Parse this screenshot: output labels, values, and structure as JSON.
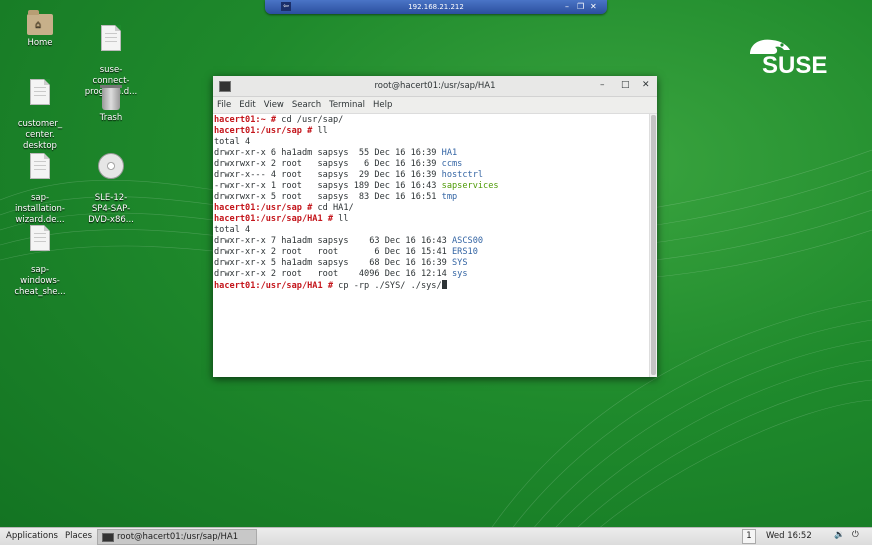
{
  "remote": {
    "address": "192.168.21.212",
    "pin_glyph": "⇦",
    "minimize_glyph": "–",
    "restore_glyph": "❐",
    "close_glyph": "✕"
  },
  "desktop": {
    "home_label": "Home",
    "suse_connect_label": "suse-\nconnect-\nprogram.d...",
    "customer_center_label": "customer_\ncenter.\ndesktop",
    "trash_label": "Trash",
    "sap_installation_label": "sap-\ninstallation-\nwizard.de...",
    "sle_dvd_label": "SLE-12-\nSP4-SAP-\nDVD-x86...",
    "sap_windows_label": "sap-\nwindows-\ncheat_she..."
  },
  "logo": {
    "text": "SUSE"
  },
  "terminal": {
    "title": "root@hacert01:/usr/sap/HA1",
    "menu": [
      "File",
      "Edit",
      "View",
      "Search",
      "Terminal",
      "Help"
    ],
    "lines": {
      "l1_prompt": "hacert01:~ #",
      "l1_cmd": " cd /usr/sap/",
      "l2_prompt": "hacert01:/usr/sap #",
      "l2_cmd": " ll",
      "l3": "total 4",
      "l4_meta": "drwxr-xr-x 6 ha1adm sapsys  55 Dec 16 16:39 ",
      "l4_name": "HA1",
      "l5_meta": "drwxrwxr-x 2 root   sapsys   6 Dec 16 16:39 ",
      "l5_name": "ccms",
      "l6_meta": "drwxr-x--- 4 root   sapsys  29 Dec 16 16:39 ",
      "l6_name": "hostctrl",
      "l7_meta": "-rwxr-xr-x 1 root   sapsys 189 Dec 16 16:43 ",
      "l7_name": "sapservices",
      "l8_meta": "drwxrwxr-x 5 root   sapsys  83 Dec 16 16:51 ",
      "l8_name": "tmp",
      "l9_prompt": "hacert01:/usr/sap #",
      "l9_cmd": " cd HA1/",
      "l10_prompt": "hacert01:/usr/sap/HA1 #",
      "l10_cmd": " ll",
      "l11": "total 4",
      "l12_meta": "drwxr-xr-x 7 ha1adm sapsys    63 Dec 16 16:43 ",
      "l12_name": "ASCS00",
      "l13_meta": "drwxr-xr-x 2 root   root       6 Dec 16 15:41 ",
      "l13_name": "ERS10",
      "l14_meta": "drwxr-xr-x 5 ha1adm sapsys    68 Dec 16 16:39 ",
      "l14_name": "SYS",
      "l15_meta": "drwxr-xr-x 2 root   root    4096 Dec 16 12:14 ",
      "l15_name": "sys",
      "l16_prompt": "hacert01:/usr/sap/HA1 #",
      "l16_cmd": " cp -rp ./SYS/ ./sys/"
    },
    "minimize_glyph": "–",
    "maximize_glyph": "□",
    "close_glyph": "✕"
  },
  "taskbar": {
    "applications": "Applications",
    "places": "Places",
    "task_label": "root@hacert01:/usr/sap/HA1",
    "workspace": "1",
    "clock": "Wed 16:52",
    "volume_glyph": "🔉",
    "power_glyph": "⏻"
  },
  "colors": {
    "desktop_green": "#1f8a2c",
    "prompt_red": "#c4161c",
    "dir_blue": "#3465a4",
    "exec_green": "#4e9a06"
  }
}
